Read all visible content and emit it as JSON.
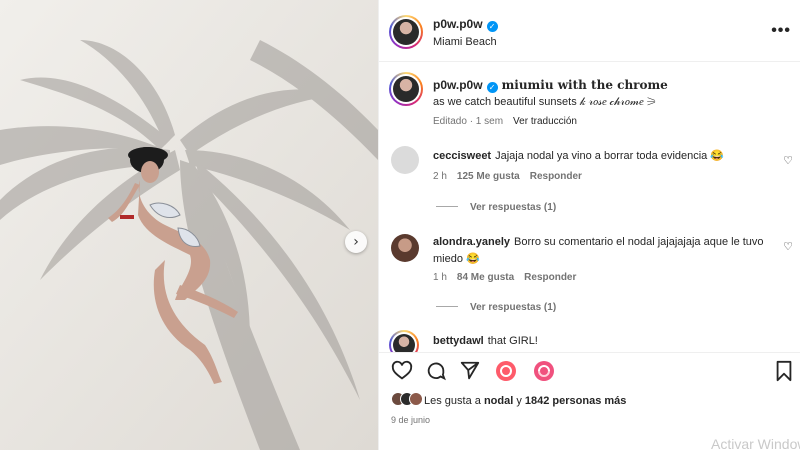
{
  "post": {
    "username": "p0w.p0w",
    "location": "Miami Beach",
    "more_label": "•••"
  },
  "caption": {
    "username": "p0w.p0w",
    "title": "miumiu with the chrome",
    "text": "as we catch beautiful sunsets 𝓀 𝓇𝑜𝓈𝑒 𝒸𝒽𝓇𝑜𝓂𝑒 ⚞",
    "edited": "Editado · 1 sem",
    "translate": "Ver traducción"
  },
  "comments": [
    {
      "username": "ceccisweet",
      "text": "Jajaja nodal ya vino a borrar toda evidencia 😂",
      "time": "2 h",
      "likes": "125 Me gusta",
      "reply": "Responder",
      "replies": "Ver respuestas (1)"
    },
    {
      "username": "alondra.yanely",
      "text": "Borro su comentario el nodal jajajajaja aque le tuvo miedo 😂",
      "time": "1 h",
      "likes": "84 Me gusta",
      "reply": "Responder",
      "replies": "Ver respuestas (1)"
    },
    {
      "username": "bettydawl",
      "text": "that GIRL!"
    }
  ],
  "likes": {
    "prefix": "Les gusta a",
    "user": "nodal",
    "mid": "y",
    "count": "1842 personas más"
  },
  "date": "9 de junio",
  "watermark": "Activar Windows",
  "icons": {
    "like": "heart-icon",
    "comment": "comment-icon",
    "share": "send-icon",
    "save": "bookmark-icon",
    "next": "chevron-right-icon"
  },
  "colors": {
    "verified": "#0095f6",
    "muted": "#737373",
    "text": "#262626"
  }
}
